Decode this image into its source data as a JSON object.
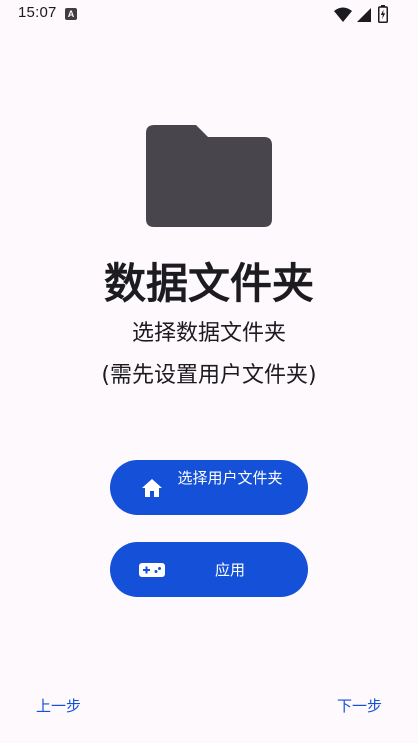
{
  "status_bar": {
    "time": "15:07",
    "notification_letter": "A",
    "icons": [
      "wifi-icon",
      "signal-icon",
      "battery-charging-icon"
    ]
  },
  "illustration": {
    "icon": "folder-icon",
    "color": "#48464c"
  },
  "title": "数据文件夹",
  "subtitle_line1": "选择数据文件夹",
  "subtitle_line2": "(需先设置用户文件夹)",
  "buttons": {
    "select_user_folder": {
      "label": "选择用户文件夹",
      "icon": "home-icon"
    },
    "apply": {
      "label": "应用",
      "icon": "gamepad-icon"
    }
  },
  "navigation": {
    "prev": "上一步",
    "next": "下一步"
  },
  "colors": {
    "accent": "#1550d8",
    "background": "#fdf9fd",
    "text": "#1c1b1f"
  }
}
